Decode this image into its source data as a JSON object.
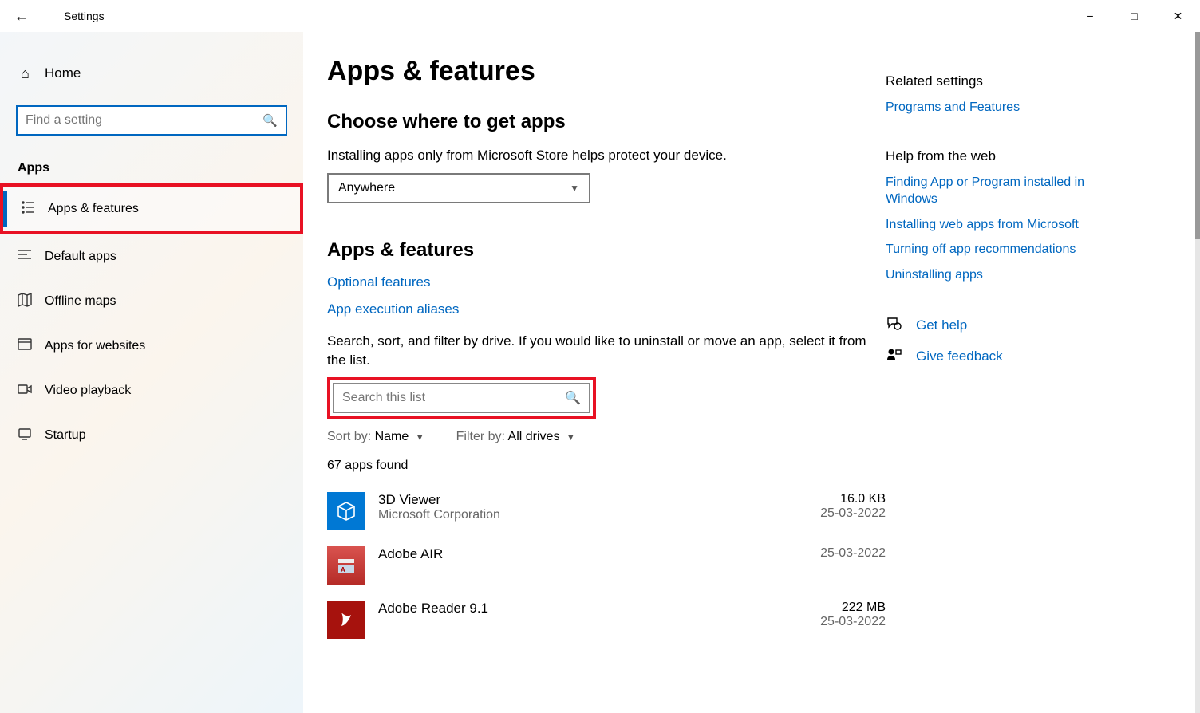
{
  "window": {
    "title": "Settings"
  },
  "sidebar": {
    "home": "Home",
    "search_placeholder": "Find a setting",
    "section": "Apps",
    "items": [
      {
        "label": "Apps & features",
        "active": true
      },
      {
        "label": "Default apps"
      },
      {
        "label": "Offline maps"
      },
      {
        "label": "Apps for websites"
      },
      {
        "label": "Video playback"
      },
      {
        "label": "Startup"
      }
    ]
  },
  "page": {
    "title": "Apps & features",
    "choose_heading": "Choose where to get apps",
    "choose_desc": "Installing apps only from Microsoft Store helps protect your device.",
    "source_value": "Anywhere",
    "sub_heading": "Apps & features",
    "link_optional": "Optional features",
    "link_aliases": "App execution aliases",
    "filter_desc": "Search, sort, and filter by drive. If you would like to uninstall or move an app, select it from the list.",
    "search_placeholder": "Search this list",
    "sort_label": "Sort by:",
    "sort_value": "Name",
    "filter_label": "Filter by:",
    "filter_value": "All drives",
    "count": "67 apps found",
    "apps": [
      {
        "name": "3D Viewer",
        "publisher": "Microsoft Corporation",
        "size": "16.0 KB",
        "date": "25-03-2022"
      },
      {
        "name": "Adobe AIR",
        "publisher": "",
        "size": "",
        "date": "25-03-2022"
      },
      {
        "name": "Adobe Reader 9.1",
        "publisher": "",
        "size": "222 MB",
        "date": "25-03-2022"
      }
    ]
  },
  "right": {
    "related_heading": "Related settings",
    "related_link": "Programs and Features",
    "help_heading": "Help from the web",
    "help_links": [
      "Finding App or Program installed in Windows",
      "Installing web apps from Microsoft",
      "Turning off app recommendations",
      "Uninstalling apps"
    ],
    "get_help": "Get help",
    "give_feedback": "Give feedback"
  }
}
